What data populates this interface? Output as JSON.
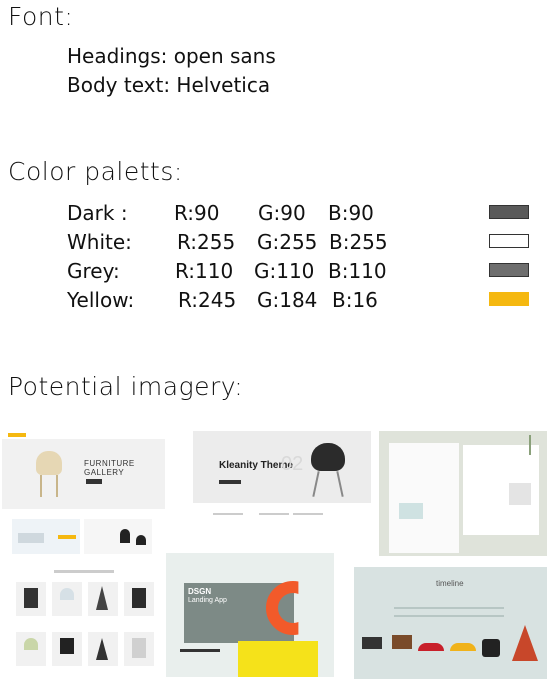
{
  "font_section": {
    "heading": "Font:",
    "headings_line": "Headings: open sans",
    "body_line": "Body text:  Helvetica"
  },
  "palette_section": {
    "heading": "Color paletts:",
    "colors": [
      {
        "name": "Dark :",
        "r": "R:90",
        "g": "G:90",
        "b": "B:90",
        "hex": "#5a5a5a"
      },
      {
        "name": "White:",
        "r": "R:255",
        "g": "G:255",
        "b": "B:255",
        "hex": "#ffffff"
      },
      {
        "name": "Grey:",
        "r": "R:110",
        "g": "G:110",
        "b": "B:110",
        "hex": "#6e6e6e"
      },
      {
        "name": "Yellow:",
        "r": "R:245",
        "g": "G:184",
        "b": "B:16",
        "hex": "#f5b810"
      }
    ]
  },
  "imagery_section": {
    "heading": "Potential imagery:",
    "images": {
      "furniture_gallery": {
        "title": "FURNITURE GALLERY"
      },
      "kleanity": {
        "title": "Kleanity Theme",
        "big_number": "02"
      },
      "dsgn": {
        "title": "DSGN",
        "subtitle": "Landing App"
      },
      "timeline": {
        "title": "timeline"
      }
    }
  }
}
